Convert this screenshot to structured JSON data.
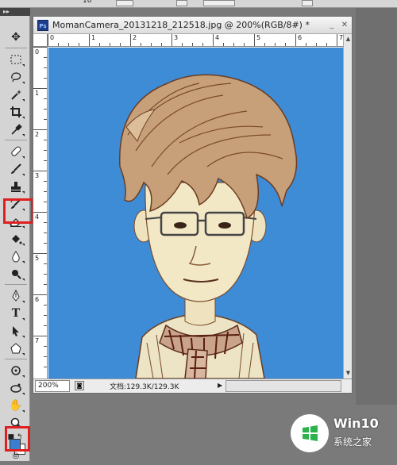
{
  "topbar": {
    "number_field": "10"
  },
  "document": {
    "title": "MomanCamera_20131218_212518.jpg @ 200%(RGB/8#) *",
    "ps_icon_label": "Ps",
    "zoom": "200%",
    "doc_info": "文档:129.3K/129.3K",
    "ruler_h_labels": [
      "0",
      "1",
      "2",
      "3",
      "4",
      "5",
      "6",
      "7"
    ],
    "ruler_v_labels": [
      "0",
      "1",
      "2",
      "3",
      "4",
      "5",
      "6",
      "7"
    ],
    "canvas_background": "#3e8bd6"
  },
  "toolbox": {
    "tools": [
      "move-tool",
      "marquee-tool",
      "lasso-tool",
      "magic-wand-tool",
      "crop-tool",
      "eyedropper-tool",
      "healing-brush-tool",
      "brush-tool",
      "clone-stamp-tool",
      "history-brush-tool",
      "eraser-tool",
      "paint-bucket-tool",
      "blur-tool",
      "dodge-tool",
      "pen-tool",
      "type-tool",
      "path-selection-tool",
      "shape-tool",
      "3d-rotate-tool",
      "3d-orbit-tool",
      "hand-tool",
      "zoom-tool"
    ],
    "selected_tool": "eraser-tool",
    "type_tool_glyph": "T",
    "foreground_color": "#3c7fd0",
    "background_color": "#ffffff"
  },
  "annotation": {
    "color": "#e02020"
  },
  "watermark": {
    "line1": "Win10",
    "line2": "系统之家"
  }
}
